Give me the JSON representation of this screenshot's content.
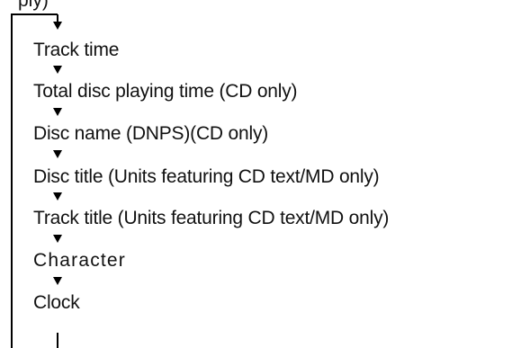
{
  "diagram": {
    "top_label": "ply)",
    "items": [
      {
        "label": "Track time"
      },
      {
        "label": "Total disc playing time (CD only)"
      },
      {
        "label": "Disc name (DNPS)(CD only)"
      },
      {
        "label": "Disc title (Units featuring CD text/MD only)"
      },
      {
        "label": "Track title (Units featuring CD text/MD only)"
      },
      {
        "label": "Character"
      },
      {
        "label": "Clock"
      }
    ]
  }
}
